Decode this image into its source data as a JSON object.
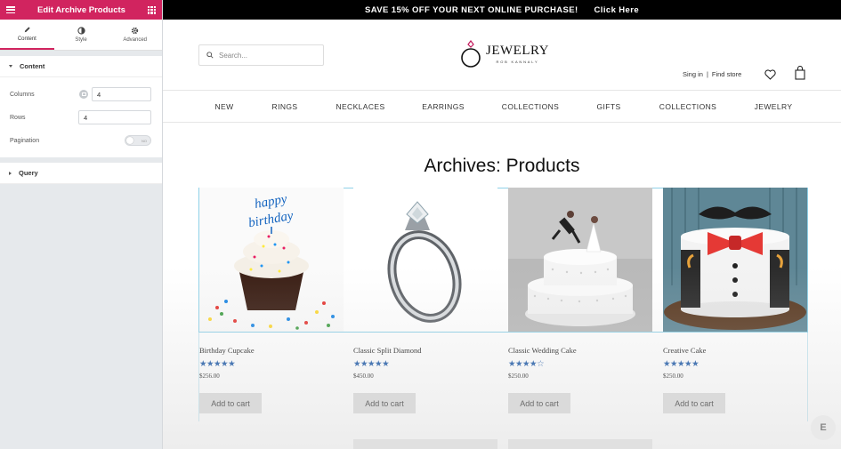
{
  "editor": {
    "title": "Edit Archive Products",
    "tabs": [
      {
        "label": "Content",
        "icon": "pencil-icon",
        "active": true
      },
      {
        "label": "Style",
        "icon": "contrast-icon",
        "active": false
      },
      {
        "label": "Advanced",
        "icon": "gear-icon",
        "active": false
      }
    ],
    "content_section": "Content",
    "columns_label": "Columns",
    "columns_value": "4",
    "rows_label": "Rows",
    "rows_value": "4",
    "pagination_label": "Pagination",
    "pagination_toggle": "NO",
    "query_section": "Query",
    "accent_color": "#d1245f"
  },
  "site": {
    "promo_text": "SAVE 15% OFF YOUR NEXT ONLINE PURCHASE!",
    "promo_link": "Click Here",
    "search_placeholder": "Search...",
    "logo_main": "JEWELRY",
    "logo_sub": "ROB KANNALY",
    "sign_in": "Sing in",
    "find_store": "Find store",
    "nav": [
      "NEW",
      "RINGS",
      "NECKLACES",
      "EARRINGS",
      "COLLECTIONS",
      "GIFTS",
      "COLLECTIONS",
      "JEWELRY"
    ],
    "page_title": "Archives: Products",
    "products": [
      {
        "name": "Birthday Cupcake",
        "rating": 5,
        "stars": "★★★★★",
        "price": "$256.00",
        "button": "Add to cart"
      },
      {
        "name": "Classic Split Diamond",
        "rating": 5,
        "stars": "★★★★★",
        "price": "$450.00",
        "button": "Add to cart"
      },
      {
        "name": "Classic Wedding Cake",
        "rating": 4,
        "stars": "★★★★☆",
        "price": "$250.00",
        "button": "Add to cart"
      },
      {
        "name": "Creative Cake",
        "rating": 5,
        "stars": "★★★★★",
        "price": "$250.00",
        "button": "Add to cart"
      }
    ],
    "star_color": "#1e5aa8"
  }
}
